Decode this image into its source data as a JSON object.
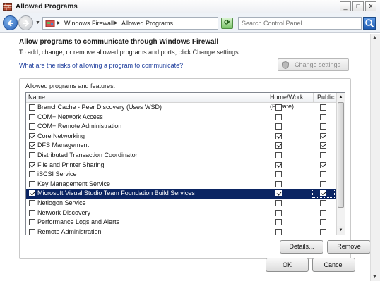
{
  "window": {
    "title": "Allowed Programs",
    "minimize": "_",
    "maximize": "□",
    "close": "X"
  },
  "address": {
    "crumbs": [
      "Windows Firewall",
      "Allowed Programs"
    ],
    "search_placeholder": "Search Control Panel"
  },
  "content": {
    "heading": "Allow programs to communicate through Windows Firewall",
    "subtext": "To add, change, or remove allowed programs and ports, click Change settings.",
    "risk_link": "What are the risks of allowing a program to communicate?",
    "change_settings": "Change settings",
    "group_label": "Allowed programs and features:",
    "columns": {
      "name": "Name",
      "home": "Home/Work (Private)",
      "public": "Public"
    },
    "programs": [
      {
        "name": "BranchCache - Peer Discovery (Uses WSD)",
        "enabled": false,
        "home": false,
        "public": false
      },
      {
        "name": "COM+ Network Access",
        "enabled": false,
        "home": false,
        "public": false
      },
      {
        "name": "COM+ Remote Administration",
        "enabled": false,
        "home": false,
        "public": false
      },
      {
        "name": "Core Networking",
        "enabled": true,
        "home": true,
        "public": true
      },
      {
        "name": "DFS Management",
        "enabled": true,
        "home": true,
        "public": true
      },
      {
        "name": "Distributed Transaction Coordinator",
        "enabled": false,
        "home": false,
        "public": false
      },
      {
        "name": "File and Printer Sharing",
        "enabled": true,
        "home": true,
        "public": true
      },
      {
        "name": "iSCSI Service",
        "enabled": false,
        "home": false,
        "public": false
      },
      {
        "name": "Key Management Service",
        "enabled": false,
        "home": false,
        "public": false
      },
      {
        "name": "Microsoft Visual Studio Team Foundation Build Services",
        "enabled": true,
        "home": true,
        "public": true,
        "selected": true
      },
      {
        "name": "Netlogon Service",
        "enabled": false,
        "home": false,
        "public": false
      },
      {
        "name": "Network Discovery",
        "enabled": false,
        "home": false,
        "public": false
      },
      {
        "name": "Performance Logs and Alerts",
        "enabled": false,
        "home": false,
        "public": false
      },
      {
        "name": "Remote Administration",
        "enabled": false,
        "home": false,
        "public": false
      }
    ],
    "details_button": "Details...",
    "remove_button": "Remove",
    "ok_button": "OK",
    "cancel_button": "Cancel"
  }
}
